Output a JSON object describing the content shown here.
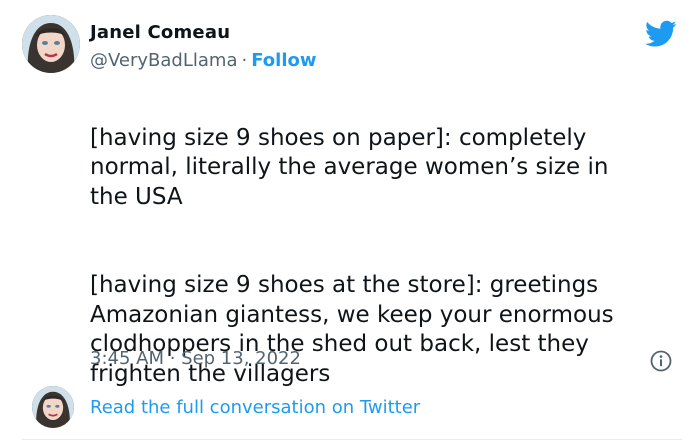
{
  "author": {
    "display_name": "Janel Comeau",
    "handle": "@VeryBadLlama",
    "separator": "·",
    "follow_label": "Follow"
  },
  "tweet": {
    "paragraph_1": "[having size 9 shoes on paper]: completely\nnormal, literally the average women’s size in\nthe USA",
    "paragraph_2": "[having size 9 shoes at the store]: greetings\nAmazonian giantess, we keep your enormous\nclodhoppers in the shed out back, lest they\nfrighten the villagers",
    "timestamp": "3:45 AM · Sep 13, 2022"
  },
  "footer": {
    "conversation_link": "Read the full conversation on Twitter"
  },
  "icons": {
    "brand": "twitter-bird-icon",
    "info": "info-icon"
  },
  "colors": {
    "accent": "#1d9bf0",
    "text": "#0f1419",
    "muted": "#536471"
  }
}
